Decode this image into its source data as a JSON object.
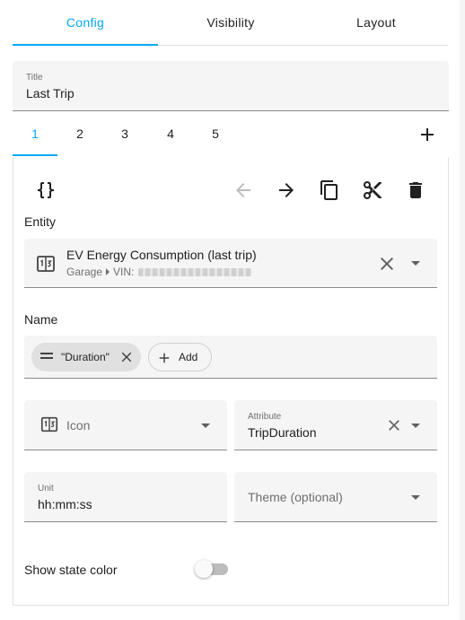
{
  "tabs": [
    {
      "label": "Config",
      "active": true
    },
    {
      "label": "Visibility",
      "active": false
    },
    {
      "label": "Layout",
      "active": false
    }
  ],
  "title_field": {
    "label": "Title",
    "value": "Last Trip"
  },
  "sub_tabs": [
    {
      "label": "1",
      "active": true
    },
    {
      "label": "2",
      "active": false
    },
    {
      "label": "3",
      "active": false
    },
    {
      "label": "4",
      "active": false
    },
    {
      "label": "5",
      "active": false
    }
  ],
  "toolbar": {
    "code_icon": "code-braces-icon",
    "actions": [
      "arrow-left-icon",
      "arrow-right-icon",
      "copy-icon",
      "cut-icon",
      "delete-icon"
    ]
  },
  "entity": {
    "section_label": "Entity",
    "name": "EV Energy Consumption (last trip)",
    "area": "Garage",
    "device_prefix": "VIN:"
  },
  "name_section": {
    "section_label": "Name",
    "chip_label": "\"Duration\"",
    "add_label": "Add"
  },
  "icon_field": {
    "placeholder": "Icon"
  },
  "attribute_field": {
    "label": "Attribute",
    "value": "TripDuration"
  },
  "unit_field": {
    "label": "Unit",
    "value": "hh:mm:ss"
  },
  "theme_field": {
    "placeholder": "Theme (optional)"
  },
  "state_color": {
    "label": "Show state color",
    "enabled": false
  },
  "colors": {
    "accent": "#03a9f4",
    "field_bg": "#f5f5f5",
    "text": "#212121",
    "secondary_text": "#6f6f6f"
  }
}
